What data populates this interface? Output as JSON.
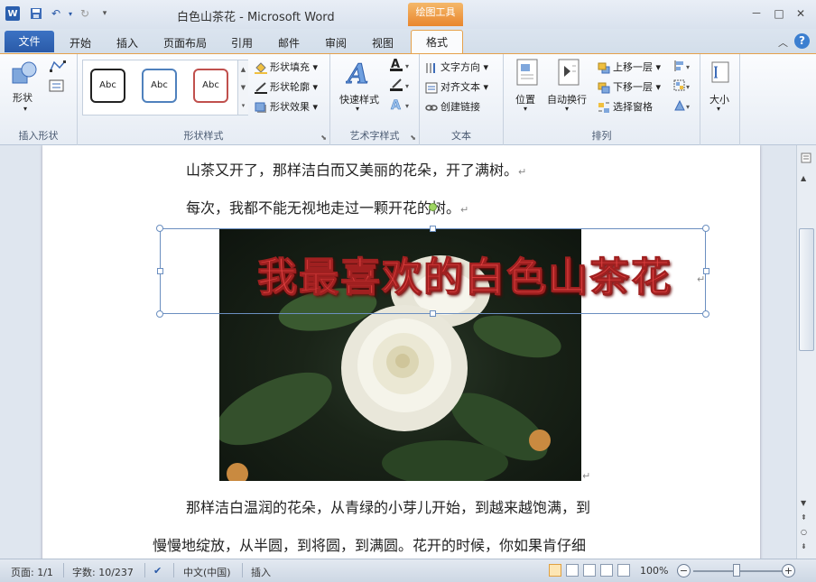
{
  "window": {
    "title": "白色山茶花 - Microsoft Word",
    "contextual_tab": "绘图工具",
    "minimize": "－",
    "restore": "□",
    "close": "✕"
  },
  "tabs": {
    "file": "文件",
    "items": [
      "开始",
      "插入",
      "页面布局",
      "引用",
      "邮件",
      "审阅",
      "视图"
    ],
    "active": "格式"
  },
  "ribbon": {
    "insert_shapes": {
      "label": "插入形状",
      "shape_btn": "形状"
    },
    "shape_styles": {
      "label": "形状样式",
      "swatches": [
        {
          "text": "Abc",
          "color": "#222222"
        },
        {
          "text": "Abc",
          "color": "#4f81bd"
        },
        {
          "text": "Abc",
          "color": "#c0504d"
        }
      ],
      "fill": "形状填充",
      "outline": "形状轮廓",
      "effects": "形状效果"
    },
    "wordart": {
      "label": "艺术字样式",
      "quick": "快速样式"
    },
    "text": {
      "label": "文本",
      "direction": "文字方向",
      "align": "对齐文本",
      "link": "创建链接"
    },
    "arrange": {
      "label": "排列",
      "position": "位置",
      "wrap": "自动换行",
      "forward": "上移一层",
      "backward": "下移一层",
      "pane": "选择窗格"
    },
    "size": {
      "label": "大小"
    }
  },
  "document": {
    "para1": "山茶又开了，那样洁白而又美丽的花朵，开了满树。",
    "para2": "每次，我都不能无视地走过一颗开花的树。",
    "wordart_text": "我最喜欢的白色山茶花",
    "para3": "那样洁白温润的花朵，从青绿的小芽儿开始，到越来越饱满，到",
    "para4": "慢慢地绽放，从半圆，到将圆，到满圆。花开的时候，你如果肯仔细",
    "para_mark": "↵"
  },
  "status": {
    "page": "页面: 1/1",
    "words": "字数: 10/237",
    "lang": "中文(中国)",
    "mode": "插入",
    "zoom": "100%",
    "zoom_minus": "−",
    "zoom_plus": "+"
  },
  "colors": {
    "accent": "#2a5aa8",
    "contextual": "#e9862d",
    "wordart": "#e04040"
  }
}
